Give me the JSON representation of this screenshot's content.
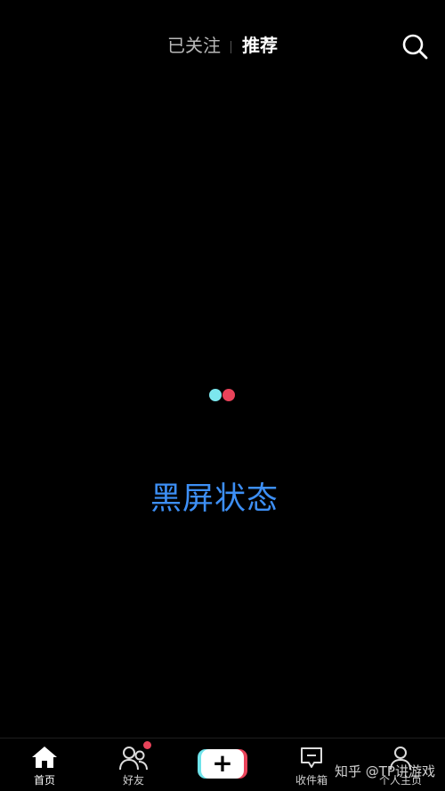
{
  "top_tabs": {
    "following": "已关注",
    "recommend": "推荐",
    "active": "recommend"
  },
  "loading": {
    "colors": [
      "#7ce7ee",
      "#e9435a"
    ]
  },
  "caption": "黑屏状态",
  "bottom_nav": {
    "items": [
      {
        "label": "首页",
        "icon": "home-icon",
        "active": true
      },
      {
        "label": "好友",
        "icon": "friends-icon",
        "badge": true
      },
      {
        "label": "+",
        "icon": "add-icon"
      },
      {
        "label": "收件箱",
        "icon": "inbox-icon"
      },
      {
        "label": "个人主页",
        "icon": "profile-icon"
      }
    ]
  },
  "watermark": "知乎 @TP讲游戏",
  "colors": {
    "background": "#000000",
    "caption": "#3d8ff5",
    "accent_red": "#e9435a",
    "accent_cyan": "#7ce7ee"
  }
}
